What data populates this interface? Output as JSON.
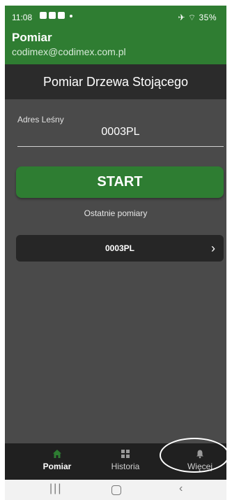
{
  "status_bar": {
    "time": "11:08",
    "right": "✈ ⌔ 35%"
  },
  "app_bar": {
    "title": "Pomiar",
    "subtitle": "codimex@codimex.com.pl"
  },
  "screen": {
    "title": "Pomiar Drzewa Stojącego",
    "field_label": "Adres Leśny",
    "field_value": "0003PL",
    "start_label": "START",
    "recent_label": "Ostatnie pomiary",
    "recent_items": [
      {
        "label": "0003PL"
      }
    ]
  },
  "bottom_nav": {
    "items": [
      {
        "label": "Pomiar",
        "icon": "home-icon",
        "active": true
      },
      {
        "label": "Historia",
        "icon": "grid-icon",
        "active": false
      },
      {
        "label": "Więcej",
        "icon": "bell-icon",
        "active": false
      }
    ]
  },
  "colors": {
    "primary_green": "#2e7d32",
    "background": "#4a4a4a",
    "header_dark": "#2b2b2b",
    "nav_dark": "#202020"
  }
}
